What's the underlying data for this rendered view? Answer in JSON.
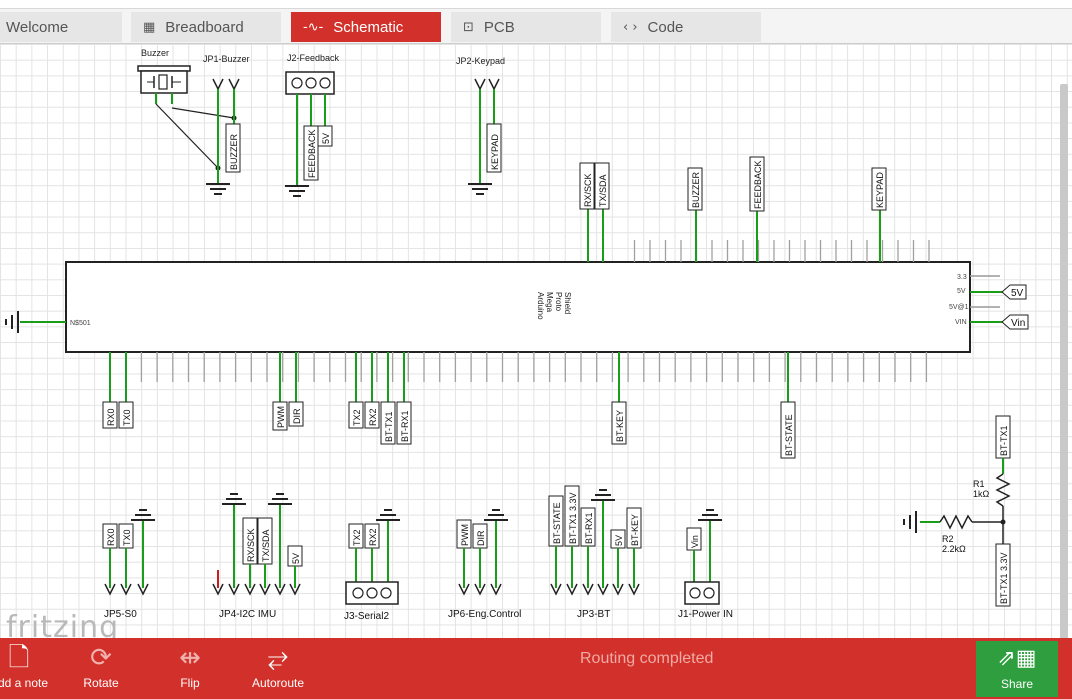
{
  "tabs": [
    {
      "label": "Welcome",
      "icon": "welcome-icon",
      "glyph": ""
    },
    {
      "label": "Breadboard",
      "icon": "breadboard-icon",
      "glyph": "▦"
    },
    {
      "label": "Schematic",
      "icon": "schematic-icon",
      "glyph": "-∿-"
    },
    {
      "label": "PCB",
      "icon": "pcb-icon",
      "glyph": "⊡"
    },
    {
      "label": "Code",
      "icon": "code-icon",
      "glyph": "‹ ›"
    }
  ],
  "active_tab": "Schematic",
  "colors": {
    "accent": "#d2302a",
    "wire": "#1a9e1a",
    "pin_highlight": "#a8e6a1",
    "share": "#2e9e3e"
  },
  "schematic": {
    "parts_top": [
      "Buzzer",
      "JP1-Buzzer",
      "J2-Feedback",
      "JP2-Keypad"
    ],
    "part_labels_top": [
      "BUZZER",
      "FEEDBACK",
      "5V",
      "KEYPAD"
    ],
    "board_label": [
      "Arduino",
      "Mega",
      "Proto",
      "Shield"
    ],
    "board_top_nets": [
      "RX/SCK",
      "TX/SDA",
      "BUZZER",
      "FEEDBACK",
      "KEYPAD"
    ],
    "board_left_pin": "N$501",
    "board_right_pins": [
      "3.3",
      "5V",
      "5V@1",
      "VIN"
    ],
    "board_right_nets": [
      "5V",
      "Vin"
    ],
    "board_bottom_nets": [
      "RX0",
      "TX0",
      "PWM",
      "DIR",
      "TX2",
      "RX2",
      "BT-TX1",
      "BT-RX1",
      "BT-KEY",
      "BT-STATE"
    ],
    "divider": {
      "r1": "R1",
      "r1_value": "1kΩ",
      "r2": "R2",
      "r2_value": "2.2kΩ",
      "top_net": "BT-TX1",
      "bottom_net": "BT-TX1 3.3V"
    },
    "headers_bottom": [
      {
        "name": "JP5-S0",
        "nets": [
          "RX0",
          "TX0"
        ]
      },
      {
        "name": "JP4-I2C IMU",
        "nets": [
          "RX/SCK",
          "TX/SDA",
          "5V"
        ]
      },
      {
        "name": "J3-Serial2",
        "nets": [
          "TX2",
          "RX2"
        ]
      },
      {
        "name": "JP6-Eng.Control",
        "nets": [
          "PWM",
          "DIR"
        ]
      },
      {
        "name": "JP3-BT",
        "nets": [
          "BT-STATE",
          "BT-TX1 3.3V",
          "BT-RX1",
          "5V",
          "BT-KEY"
        ]
      },
      {
        "name": "J1-Power IN",
        "nets": [
          "Vin"
        ]
      }
    ],
    "watermark": "fritzing"
  },
  "toolbar": {
    "items": [
      {
        "label": "Add a note",
        "icon": "note-icon"
      },
      {
        "label": "Rotate",
        "icon": "rotate-icon"
      },
      {
        "label": "Flip",
        "icon": "flip-icon"
      },
      {
        "label": "Autoroute",
        "icon": "autoroute-icon"
      }
    ],
    "status": "Routing completed",
    "share_label": "Share",
    "share_icon": "share-icon"
  }
}
